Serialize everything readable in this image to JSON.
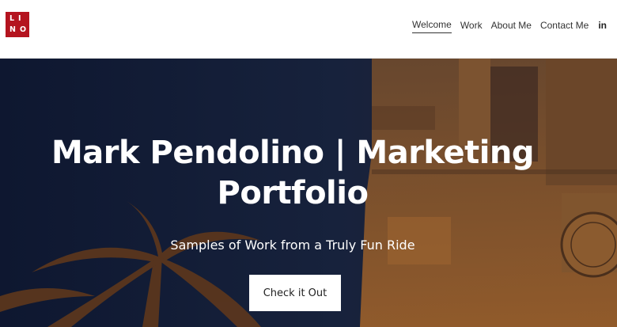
{
  "logo": {
    "letters": [
      "LI",
      "NO"
    ]
  },
  "nav": {
    "items": [
      {
        "label": "Welcome",
        "active": true
      },
      {
        "label": "Work"
      },
      {
        "label": "About Me"
      },
      {
        "label": "Contact Me"
      }
    ],
    "social_icon": "in"
  },
  "hero": {
    "title_line1": "Mark Pendolino | Marketing",
    "title_line2": "Portfolio",
    "subtitle": "Samples of Work from a Truly Fun Ride",
    "button_label": "Check it Out"
  },
  "colors": {
    "brand": "#b4141f",
    "hero_overlay": "#101a36",
    "stone": "#8a5a2e"
  }
}
